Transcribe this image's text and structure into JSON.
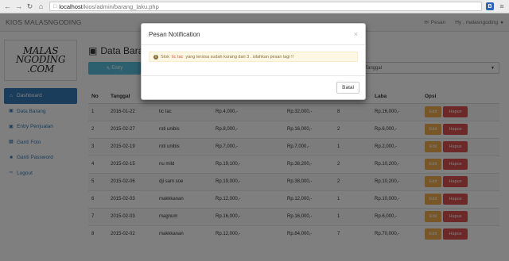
{
  "browser": {
    "url_host": "localhost",
    "url_path": "/kios/admin/barang_laku.php",
    "ext_b": "B"
  },
  "navbar": {
    "brand": "KIOS MALASNGODING",
    "pesan": "Pesan",
    "user": "Hy , malasngoding"
  },
  "logo": {
    "line1": "MALAS",
    "line2": "NGODING",
    "line3": ".COM"
  },
  "sidebar": {
    "items": [
      {
        "label": "Dashboard",
        "icon": "home-icon"
      },
      {
        "label": "Data Barang",
        "icon": "briefcase-icon"
      },
      {
        "label": "Entry Penjualan",
        "icon": "briefcase-icon"
      },
      {
        "label": "Ganti Foto",
        "icon": "picture-icon"
      },
      {
        "label": "Ganti Password",
        "icon": "lock-icon"
      },
      {
        "label": "Logout",
        "icon": "logout-icon"
      }
    ]
  },
  "main": {
    "title": "Data Barang",
    "entry_btn": "Entry",
    "select_value": "Tanggal"
  },
  "table": {
    "headers": [
      "No",
      "Tanggal",
      "",
      "",
      "",
      "",
      "Laba",
      "Opsi"
    ],
    "rows": [
      [
        "1",
        "2016-01-22",
        "tic tac",
        "Rp.4,000,-",
        "Rp.32,000,-",
        "8",
        "Rp.16,000,-"
      ],
      [
        "2",
        "2015-02-27",
        "roti unibis",
        "Rp.8,000,-",
        "Rp.16,000,-",
        "2",
        "Rp.6,000,-"
      ],
      [
        "3",
        "2015-02-19",
        "roti unibis",
        "Rp.7,000,-",
        "Rp.7,000,-",
        "1",
        "Rp.2,000,-"
      ],
      [
        "4",
        "2015-02-15",
        "nu mild",
        "Rp.19,100,-",
        "Rp.38,200,-",
        "2",
        "Rp.10,200,-"
      ],
      [
        "5",
        "2015-02-06",
        "dji sam soe",
        "Rp.19,000,-",
        "Rp.38,000,-",
        "2",
        "Rp.10,200,-"
      ],
      [
        "6",
        "2015-02-03",
        "makkkanan",
        "Rp.12,000,-",
        "Rp.12,000,-",
        "1",
        "Rp.10,000,-"
      ],
      [
        "7",
        "2015-02-03",
        "magnum",
        "Rp.16,000,-",
        "Rp.16,000,-",
        "1",
        "Rp.6,000,-"
      ],
      [
        "8",
        "2015-02-02",
        "makkkanan",
        "Rp.12,000,-",
        "Rp.84,000,-",
        "7",
        "Rp.70,000,-"
      ]
    ],
    "edit_label": "Edit",
    "hapus_label": "Hapus"
  },
  "modal": {
    "title": "Pesan Notification",
    "close": "×",
    "alert_prefix": "Stok",
    "alert_item": "tic tac",
    "alert_suffix": "yang tersisa sudah kurang dari 3 . silahkan pesan lagi !!",
    "batal": "Batal"
  }
}
